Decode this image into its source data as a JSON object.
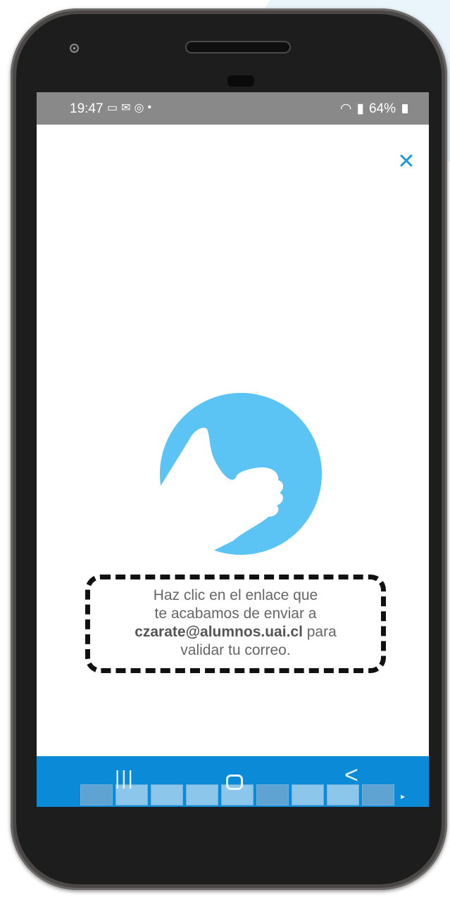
{
  "status_bar": {
    "time": "19:47",
    "icons": [
      "laptop-icon",
      "mail-icon",
      "instagram-icon",
      "dot-icon"
    ],
    "battery_text": "64%",
    "right_icons": [
      "wifi-icon",
      "signal-icon",
      "battery-icon"
    ]
  },
  "close_glyph": "✕",
  "message": {
    "line1": "Haz clic en el enlace que",
    "line2": "te acabamos de enviar a",
    "email": "czarate@alumnos.uai.cl",
    "line3_suffix": " para",
    "line4": "validar tu correo."
  },
  "nav": {
    "recent_glyph": "|||",
    "back_glyph": "<"
  },
  "colors": {
    "accent": "#0b8bd7",
    "icon_circle": "#5bc4f5",
    "status_bar": "#898989"
  }
}
